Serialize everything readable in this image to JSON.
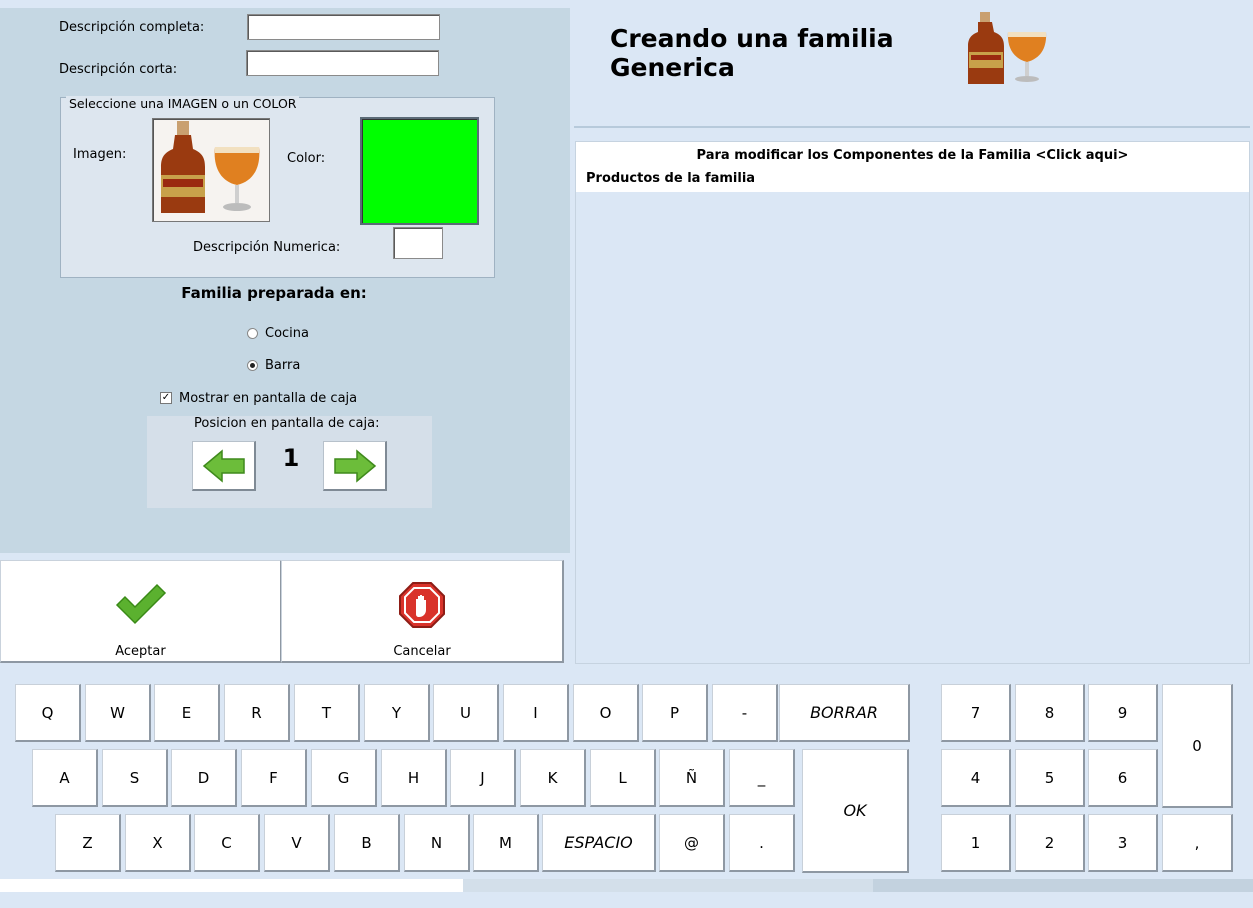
{
  "form": {
    "full_description_label": "Descripción completa:",
    "full_description_value": "",
    "short_description_label": "Descripción corta:",
    "short_description_value": "",
    "image_group_legend": "Seleccione una IMAGEN o un COLOR",
    "image_label": "Imagen:",
    "color_label": "Color:",
    "selected_color": "#00ff00",
    "numeric_description_label": "Descripción Numerica:",
    "numeric_description_value": "",
    "prepared_in_title": "Familia preparada en:",
    "prepared_options": [
      {
        "label": "Cocina",
        "selected": false
      },
      {
        "label": "Barra",
        "selected": true
      }
    ],
    "show_on_register_label": "Mostrar en pantalla de caja",
    "show_on_register_checked": true,
    "position_label": "Posicion en pantalla de caja:",
    "position_value": "1"
  },
  "actions": {
    "accept_label": "Aceptar",
    "cancel_label": "Cancelar"
  },
  "header": {
    "title_line1": "Creando una familia",
    "title_line2": "Generica"
  },
  "components": {
    "modify_link": "Para modificar los Componentes de la Familia <Click aqui>",
    "products_label": "Productos de la familia"
  },
  "keyboard": {
    "row1": [
      "Q",
      "W",
      "E",
      "R",
      "T",
      "Y",
      "U",
      "I",
      "O",
      "P",
      "-"
    ],
    "borrar": "BORRAR",
    "row2": [
      "A",
      "S",
      "D",
      "F",
      "G",
      "H",
      "J",
      "K",
      "L",
      "Ñ",
      "_"
    ],
    "ok": "OK",
    "row3a": [
      "Z",
      "X",
      "C",
      "V",
      "B",
      "N",
      "M"
    ],
    "espacio": "ESPACIO",
    "row3b": [
      "@",
      "."
    ]
  },
  "numpad": {
    "row1": [
      "7",
      "8",
      "9"
    ],
    "row2": [
      "4",
      "5",
      "6"
    ],
    "row3": [
      "1",
      "2",
      "3"
    ],
    "zero": "0",
    "comma": ","
  },
  "colors": {
    "panel_bg": "#c5d7e3",
    "page_bg": "#dbe7f5",
    "accept_green": "#5bb12f",
    "cancel_red": "#d9332b"
  }
}
